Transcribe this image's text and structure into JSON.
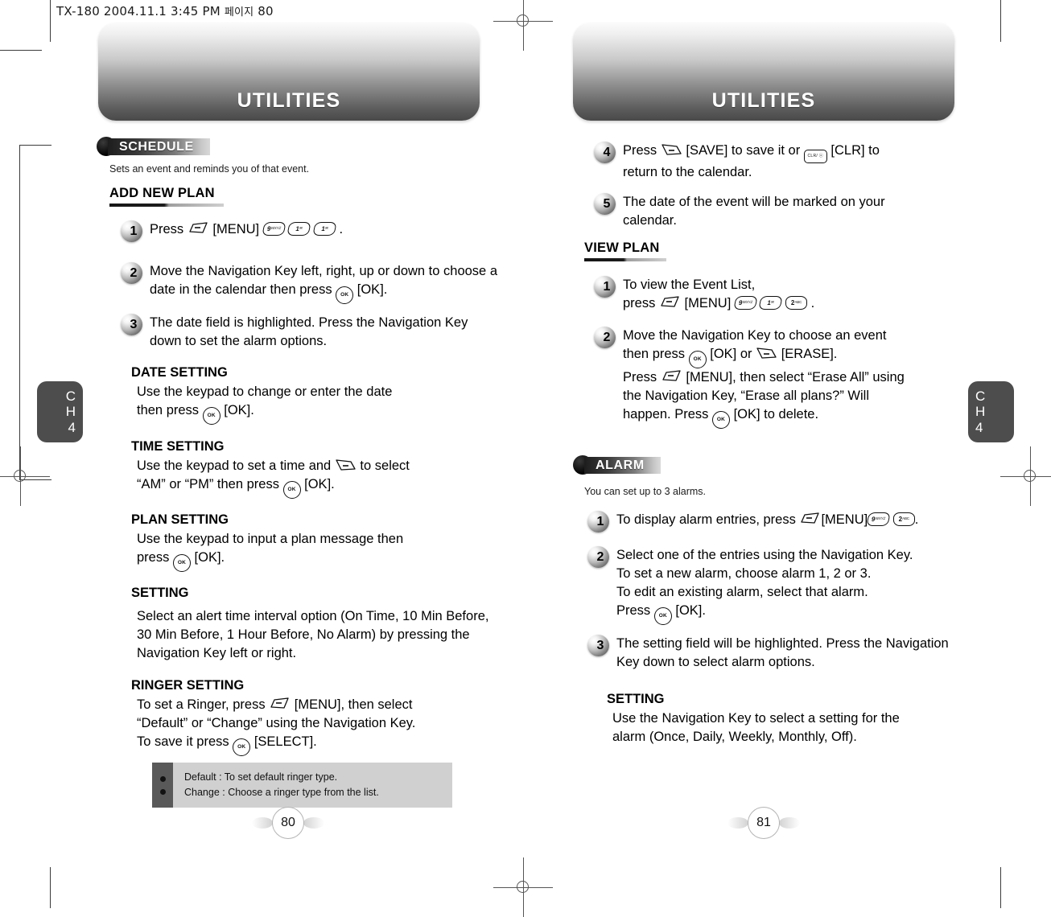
{
  "scan_header": {
    "text": "TX-180  2004.11.1 3:45 PM",
    "korean": "페이지",
    "page": "80"
  },
  "spreads": [
    {
      "banner_title": "UTILITIES",
      "page_number": "80",
      "chapter_tab": {
        "line1": "C",
        "line2": "H",
        "line3": "4"
      }
    },
    {
      "banner_title": "UTILITIES",
      "page_number": "81",
      "chapter_tab": {
        "line1": "C",
        "line2": "H",
        "line3": "4"
      }
    }
  ],
  "left_page": {
    "section": {
      "badge": "SCHEDULE",
      "note": "Sets an event and reminds you of that event."
    },
    "subhead": "ADD NEW PLAN",
    "steps": [
      {
        "num": "1",
        "prefix": "Press",
        "suffix": "[MENU]",
        "tail": "."
      },
      {
        "num": "2",
        "text": "Move the Navigation Key left, right, up or down to choose a date in the calendar then press"
      },
      {
        "num": "3",
        "text": "The date field is highlighted. Press the Navigation Key down to set the alarm options."
      }
    ],
    "blocks": [
      {
        "heading": "DATE SETTING",
        "line1": "Use the keypad to change or enter the date",
        "line2_a": "then press",
        "line2_b": "[OK]."
      },
      {
        "heading": "TIME SETTING",
        "line1_a": "Use the keypad to set a time and",
        "line1_b": "to select",
        "line2_a": "“AM” or “PM” then press",
        "line2_b": "[OK]."
      },
      {
        "heading": "PLAN SETTING",
        "line1": "Use the keypad to input a plan message then",
        "line2_a": "press",
        "line2_b": "[OK]."
      },
      {
        "heading": "SETTING",
        "body": "Select an alert time interval option (On Time, 10 Min Before, 30 Min Before, 1 Hour Before, No Alarm) by pressing the Navigation Key left or right."
      },
      {
        "heading": "RINGER SETTING",
        "line1_a": "To set a Ringer, press",
        "line1_b": "[MENU], then select",
        "line2": "“Default” or “Change” using the Navigation Key.",
        "line3_a": "To save it press",
        "line3_b": "[SELECT]."
      }
    ],
    "step2_tail": "[OK].",
    "note_box": [
      "Default : To set default ringer type.",
      "Change : Choose a ringer type from the list."
    ]
  },
  "right_page": {
    "steps_top": [
      {
        "num": "4",
        "a": "Press",
        "b": "[SAVE] to save it or",
        "c": "[CLR] to",
        "d": "return to the calendar."
      },
      {
        "num": "5",
        "text": "The date of the event will be marked on your calendar."
      }
    ],
    "subhead": "VIEW PLAN",
    "view_steps": [
      {
        "num": "1",
        "line1": "To view the Event List,",
        "line2_a": "press",
        "line2_b": "[MENU]",
        "line2_c": "."
      },
      {
        "num": "2",
        "line1": "Move the Navigation Key to choose an event",
        "line2_a": "then press",
        "line2_b": "[OK] or",
        "line2_c": "[ERASE].",
        "line3_a": "Press",
        "line3_b": "[MENU], then select “Erase All” using",
        "line4": "the Navigation Key, “Erase all plans?” Will",
        "line5_a": "happen. Press",
        "line5_b": "[OK] to delete."
      }
    ],
    "alarm_section": {
      "badge": "ALARM",
      "note": "You can set up to 3 alarms."
    },
    "alarm_steps": [
      {
        "num": "1",
        "a": "To display alarm entries, press",
        "b": "[MENU]",
        "c": "."
      },
      {
        "num": "2",
        "line1": "Select one of the entries using the Navigation Key.",
        "line2": "To set a new alarm, choose alarm 1, 2 or 3.",
        "line3": "To edit an existing alarm, select that alarm.",
        "line4_a": "Press",
        "line4_b": "[OK]."
      },
      {
        "num": "3",
        "text": "The setting field will be highlighted. Press the Navigation Key down to select alarm options."
      }
    ],
    "setting_block": {
      "heading": "SETTING",
      "line1": "Use the Navigation Key to select a setting for the",
      "line2": "alarm (Once, Daily, Weekly, Monthly, Off)."
    }
  },
  "keys": {
    "ok": "OK",
    "clr": "CLR/ ⓧ",
    "nine": "9",
    "nine_sup": "WXYZ",
    "one": "1",
    "one_sup": "✉",
    "two": "2",
    "two_sup": "ABC"
  }
}
